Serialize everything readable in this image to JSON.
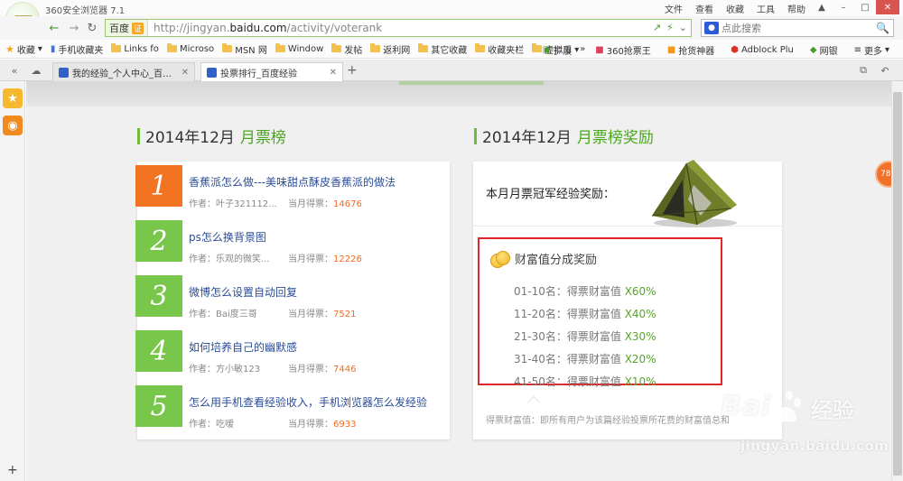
{
  "browser": {
    "title": "360安全浏览器 7.1",
    "menu": [
      "文件",
      "查看",
      "收藏",
      "工具",
      "帮助"
    ],
    "address": {
      "badge_label": "百度",
      "badge_verified": "证",
      "url_prefix": "http://jingyan.",
      "url_domain": "baidu.com",
      "url_path": "/activity/voterank"
    },
    "search_placeholder": "点此搜索",
    "bookmarks": [
      "收藏",
      "手机收藏夹",
      "Links fo",
      "Microso",
      "MSN 网",
      "Window",
      "发帖",
      "返利网",
      "其它收藏",
      "收藏夹栏",
      "虚拟币"
    ],
    "right_bookmarks": [
      "扩展",
      "360抢票王",
      "抢货神器",
      "Adblock Plu",
      "网银",
      "更多"
    ],
    "tabs": [
      {
        "title": "我的经验_个人中心_百度经验",
        "active": false
      },
      {
        "title": "投票排行_百度经验",
        "active": true
      }
    ]
  },
  "page": {
    "left_title": {
      "date": "2014年12月",
      "name": "月票榜"
    },
    "right_title": {
      "date": "2014年12月",
      "name": "月票榜奖励"
    },
    "author_label": "作者：",
    "votes_label": "当月得票：",
    "ranking": [
      {
        "rank": "1",
        "title": "香蕉派怎么做---美味甜点酥皮香蕉派的做法",
        "author": "叶子321112...",
        "votes": "14676"
      },
      {
        "rank": "2",
        "title": "ps怎么换背景图",
        "author": "乐观的微笑...",
        "votes": "12226"
      },
      {
        "rank": "3",
        "title": "微博怎么设置自动回复",
        "author": "Bai度三哥",
        "votes": "7521"
      },
      {
        "rank": "4",
        "title": "如何培养自己的幽默感",
        "author": "方小敏123",
        "votes": "7446"
      },
      {
        "rank": "5",
        "title": "怎么用手机查看经验收入，手机浏览器怎么发经验",
        "author": "吃嗳",
        "votes": "6933"
      }
    ],
    "reward": {
      "caption": "本月月票冠军经验奖励：",
      "wealth_title": "财富值分成奖励",
      "tiers": [
        {
          "range": "01-10名",
          "label": "：得票财富值 ",
          "pct": "X60%"
        },
        {
          "range": "11-20名",
          "label": "：得票财富值 ",
          "pct": "X40%"
        },
        {
          "range": "21-30名",
          "label": "：得票财富值 ",
          "pct": "X30%"
        },
        {
          "range": "31-40名",
          "label": "：得票财富值 ",
          "pct": "X20%"
        },
        {
          "range": "41-50名",
          "label": "：得票财富值 ",
          "pct": "X10%"
        }
      ],
      "footnote": "得票财富值：即所有用户为该篇经验投票所花费的财富值总和"
    },
    "float_badge": "78",
    "watermark": {
      "brand": "Bai",
      "brand2": "经验",
      "url": "jingyan.baidu.com"
    }
  },
  "colors": {
    "green": "#4aa81f",
    "orange": "#f27321",
    "link": "#2a4c97",
    "highlight": "#e0262a"
  }
}
